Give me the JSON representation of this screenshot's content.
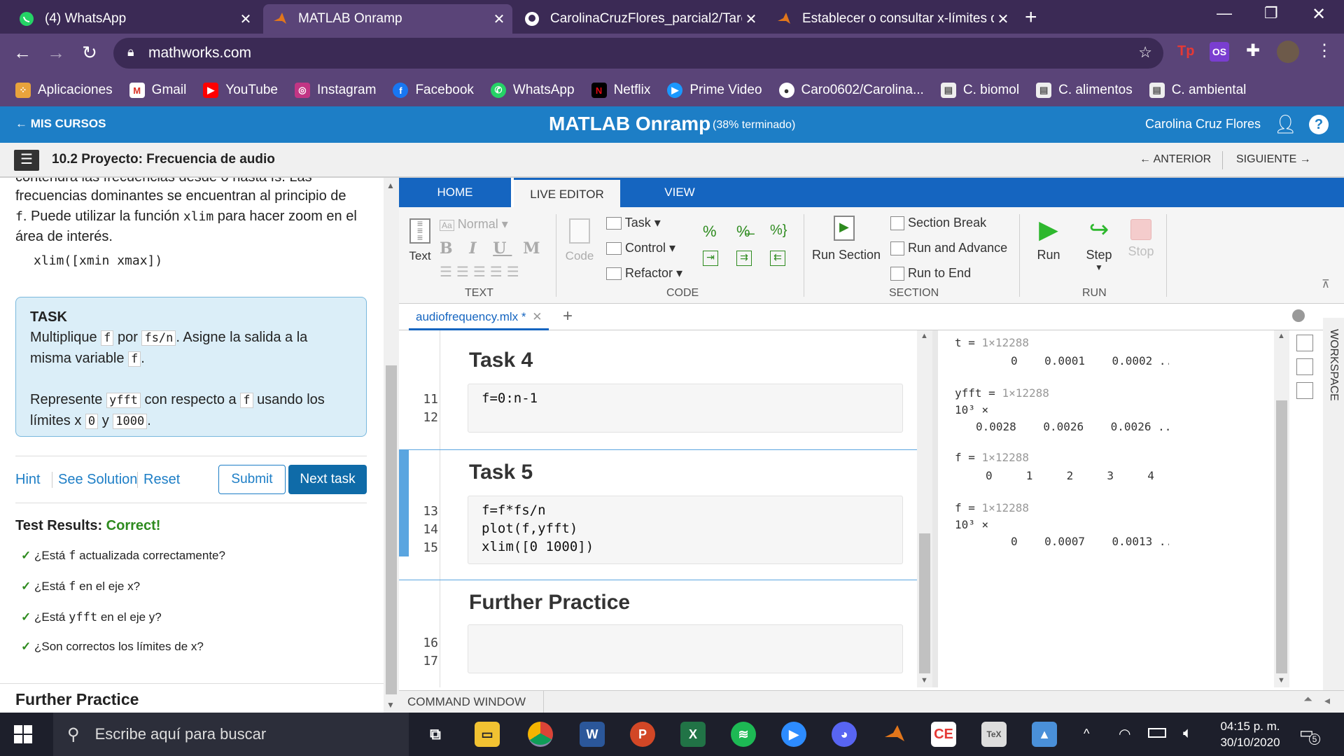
{
  "browser": {
    "tabs": [
      {
        "title": "(4) WhatsApp",
        "icon": "whatsapp-icon"
      },
      {
        "title": "MATLAB Onramp",
        "icon": "matlab-icon"
      },
      {
        "title": "CarolinaCruzFlores_parcial2/Tare",
        "icon": "github-icon"
      },
      {
        "title": "Establecer o consultar x-límites d",
        "icon": "matlab-icon"
      }
    ],
    "url": "mathworks.com",
    "bookmarks": [
      {
        "label": "Aplicaciones",
        "icon": "apps-icon"
      },
      {
        "label": "Gmail",
        "icon": "gmail-icon"
      },
      {
        "label": "YouTube",
        "icon": "youtube-icon"
      },
      {
        "label": "Instagram",
        "icon": "instagram-icon"
      },
      {
        "label": "Facebook",
        "icon": "facebook-icon"
      },
      {
        "label": "WhatsApp",
        "icon": "whatsapp-icon"
      },
      {
        "label": "Netflix",
        "icon": "netflix-icon"
      },
      {
        "label": "Prime Video",
        "icon": "prime-video-icon"
      },
      {
        "label": "Caro0602/Carolina...",
        "icon": "github-icon"
      },
      {
        "label": "C. biomol",
        "icon": "document-icon"
      },
      {
        "label": "C. alimentos",
        "icon": "document-icon"
      },
      {
        "label": "C. ambiental",
        "icon": "document-icon"
      }
    ]
  },
  "course": {
    "back_label": "MIS CURSOS",
    "title": "MATLAB Onramp",
    "progress": "(38% terminado)",
    "user": "Carolina Cruz Flores",
    "project_title": "10.2 Proyecto: Frecuencia de audio",
    "prev_label": "ANTERIOR",
    "next_label": "SIGUIENTE"
  },
  "instructions": {
    "cut_line": "contendrá las frecuencias desde 0 hasta fs. Las",
    "p1_a": "frecuencias dominantes se encuentran al principio de",
    "p1_code": "f",
    "p1_b": ". Puede utilizar la función",
    "p1_code2": "xlim",
    "p1_c": "para hacer zoom en el",
    "p1_d": "área de interés.",
    "syntax": "xlim([xmin xmax])"
  },
  "task": {
    "heading": "TASK",
    "l1_a": "Multiplique",
    "l1_c1": "f",
    "l1_b": "por",
    "l1_c2": "fs/n",
    "l1_c": ". Asigne la salida a la",
    "l2_a": "misma variable",
    "l2_c1": "f",
    "l2_b": ".",
    "l3_a": "Represente",
    "l3_c1": "yfft",
    "l3_b": "con respecto a",
    "l3_c2": "f",
    "l3_c": "usando los",
    "l4_a": "límites x",
    "l4_c1": "0",
    "l4_b": "y",
    "l4_c2": "1000",
    "l4_c": "."
  },
  "actions": {
    "hint": "Hint",
    "solution": "See Solution",
    "reset": "Reset",
    "submit": "Submit",
    "next": "Next task"
  },
  "results": {
    "label": "Test Results:",
    "status": "Correct!",
    "checks": [
      {
        "pre": "¿Está",
        "code": "f",
        "post": "actualizada correctamente?"
      },
      {
        "pre": "¿Está",
        "code": "f",
        "post": "en el eje x?"
      },
      {
        "pre": "¿Está",
        "code": "yfft",
        "post": "en el eje y?"
      },
      {
        "pre": "¿Son correctos los límites de x?",
        "code": "",
        "post": ""
      }
    ],
    "further": "Further Practice"
  },
  "ribbon": {
    "tabs": [
      "HOME",
      "LIVE EDITOR",
      "VIEW"
    ],
    "active_tab": "LIVE EDITOR",
    "text_group": {
      "label": "TEXT",
      "text_btn": "Text",
      "style": "Normal"
    },
    "code_group": {
      "label": "CODE",
      "code_btn": "Code",
      "task": "Task",
      "control": "Control",
      "refactor": "Refactor"
    },
    "section_group": {
      "label": "SECTION",
      "run_section": "Run Section",
      "section_break": "Section Break",
      "run_advance": "Run and Advance",
      "run_end": "Run to End"
    },
    "run_group": {
      "label": "RUN",
      "run": "Run",
      "step": "Step",
      "stop": "Stop"
    }
  },
  "editor": {
    "file_tab": "audiofrequency.mlx *",
    "sections": [
      {
        "title": "Task 4",
        "lines": [
          {
            "n": "11",
            "code": "f=0:n-1"
          },
          {
            "n": "12",
            "code": ""
          }
        ]
      },
      {
        "title": "Task 5",
        "lines": [
          {
            "n": "13",
            "code": "f=f*fs/n"
          },
          {
            "n": "14",
            "code": "plot(f,yfft)"
          },
          {
            "n": "15",
            "code": "xlim([0 1000])"
          }
        ]
      },
      {
        "title": "Further Practice",
        "lines": [
          {
            "n": "16",
            "code": ""
          },
          {
            "n": "17",
            "code": ""
          }
        ]
      }
    ],
    "command_window": "COMMAND WINDOW",
    "workspace": "WORKSPACE"
  },
  "output": [
    {
      "var": "t",
      "size": "1×12288",
      "scale": "",
      "values": "0    0.0001    0.0002 ..."
    },
    {
      "var": "yfft",
      "size": "1×12288",
      "scale": "10³ ×",
      "values": "0.0028    0.0026    0.0026 ..."
    },
    {
      "var": "f",
      "size": "1×12288",
      "scale": "",
      "values": "0     1     2     3     4     5 ..."
    },
    {
      "var": "f",
      "size": "1×12288",
      "scale": "10³ ×",
      "values": "0    0.0007    0.0013 ..."
    }
  ],
  "taskbar": {
    "search": "Escribe aquí para buscar",
    "time": "04:15 p. m.",
    "date": "30/10/2020",
    "notif_count": "5"
  },
  "colors": {
    "browser_dark": "#3b2a55",
    "browser_mid": "#5a4478",
    "mathworks_blue": "#1d7ec6",
    "matlab_tab_blue": "#1565c0",
    "correct_green": "#2e8b1f"
  }
}
